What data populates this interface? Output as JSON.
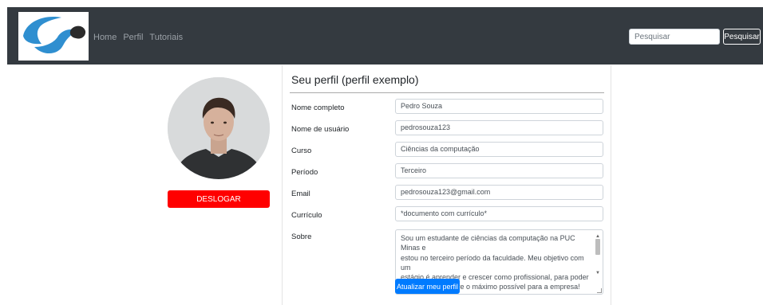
{
  "navbar": {
    "links": [
      "Home",
      "Perfil",
      "Tutoriais"
    ],
    "search_placeholder": "Pesquisar",
    "search_button": "Pesquisar"
  },
  "sidebar": {
    "logout_label": "DESLOGAR"
  },
  "profile": {
    "title": "Seu perfil (perfil exemplo)",
    "fields": [
      {
        "label": "Nome completo",
        "value": "Pedro Souza"
      },
      {
        "label": "Nome de usuário",
        "value": "pedrosouza123"
      },
      {
        "label": "Curso",
        "value": "Ciências da computação"
      },
      {
        "label": "Período",
        "value": "Terceiro"
      },
      {
        "label": "Email",
        "value": "pedrosouza123@gmail.com"
      },
      {
        "label": "Currículo",
        "value": "*documento com currículo*"
      }
    ],
    "about_label": "Sobre",
    "about_lines": [
      "Sou um estudante de ciências da computação na PUC Minas e",
      "estou no terceiro período da faculdade. Meu objetivo com um",
      "estágio é aprender e crescer como profissional, para poder",
      "acrescentar sempre o máximo possível para a empresa! Sou"
    ],
    "update_button": "Atualizar meu perfil"
  },
  "colors": {
    "navbar": "#343a40",
    "logout": "#ff0000",
    "primary": "#007bff"
  }
}
